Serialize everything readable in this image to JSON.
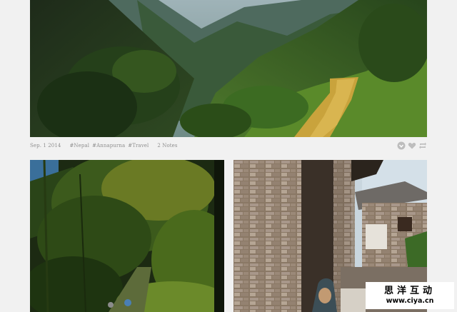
{
  "post": {
    "date": "Sep. 1 2014",
    "tags": [
      "#Nepal",
      "#Annapurna",
      "#Travel"
    ],
    "notes": "2 Notes",
    "actions": {
      "share_icon": "share-icon",
      "like_icon": "heart-icon",
      "reblog_icon": "reblog-icon"
    }
  },
  "photos": [
    {
      "subject": "mountain-valley-trail"
    },
    {
      "subject": "jungle-forest-path"
    },
    {
      "subject": "stone-village-alley"
    }
  ],
  "watermark": {
    "title": "思洋互动",
    "url": "www.ciya.cn"
  },
  "colors": {
    "page_bg": "#f1f1f1",
    "meta_text": "#8f8f8f",
    "icon": "#bdbdbd"
  }
}
